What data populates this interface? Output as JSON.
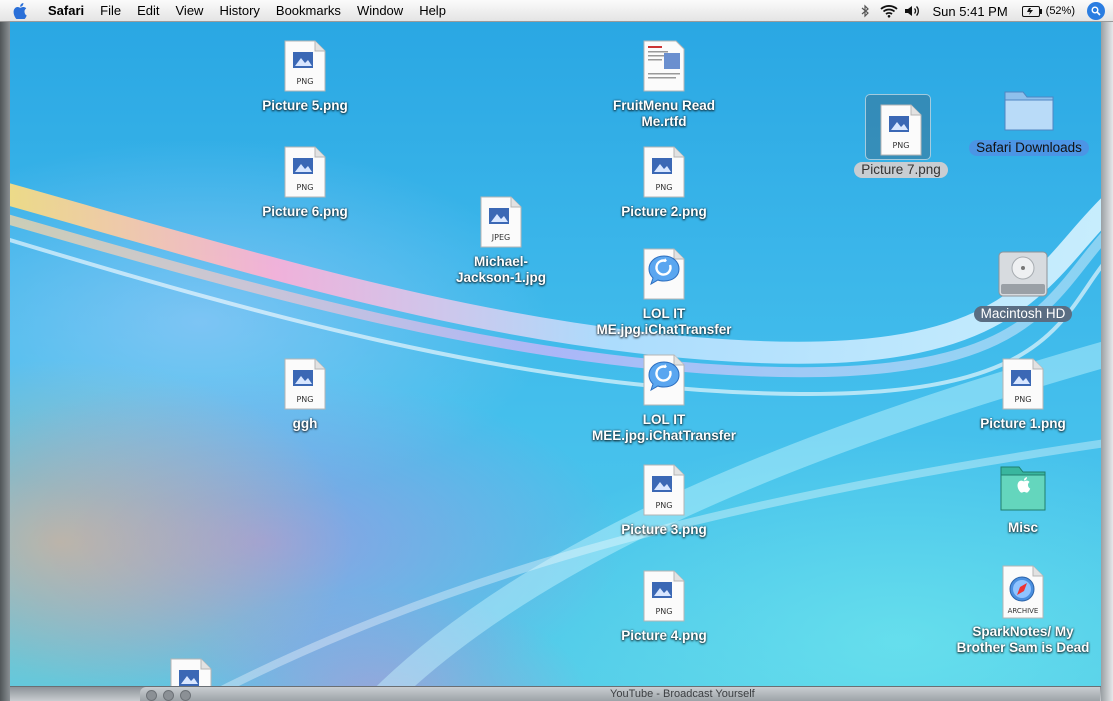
{
  "menubar": {
    "app": "Safari",
    "items": [
      "File",
      "Edit",
      "View",
      "History",
      "Bookmarks",
      "Window",
      "Help"
    ],
    "clock": "Sun 5:41 PM",
    "battery": "(52%)"
  },
  "desktop_icons": {
    "picture5": {
      "name": "Picture 5.png",
      "badge": "PNG"
    },
    "picture6": {
      "name": "Picture 6.png",
      "badge": "PNG"
    },
    "ggh": {
      "name": "ggh",
      "badge": "PNG"
    },
    "michael": {
      "name": "Michael-Jackson-1.jpg",
      "line1": "Michael-",
      "line2": "Jackson-1.jpg",
      "badge": "JPEG"
    },
    "fruitmenu": {
      "line1": "FruitMenu Read",
      "line2": "Me.rtfd"
    },
    "picture2": {
      "name": "Picture 2.png",
      "badge": "PNG"
    },
    "lolit1": {
      "line1": "LOL IT",
      "line2": "ME.jpg.iChatTransfer"
    },
    "lolit2": {
      "line1": "LOL IT",
      "line2": "MEE.jpg.iChatTransfer"
    },
    "picture3": {
      "name": "Picture 3.png",
      "badge": "PNG"
    },
    "picture4": {
      "name": "Picture 4.png",
      "badge": "PNG"
    },
    "picture7": {
      "name": "Picture 7.png",
      "badge": "PNG"
    },
    "safari_downloads": {
      "name": "Safari Downloads"
    },
    "macintosh_hd": {
      "name": "Macintosh HD"
    },
    "picture1": {
      "name": "Picture 1.png",
      "badge": "PNG"
    },
    "misc": {
      "name": "Misc"
    },
    "sparknotes": {
      "line1": "SparkNotes/ My",
      "line2": "Brother Sam is Dead",
      "badge": "ARCHIVE"
    }
  },
  "bottom_window": {
    "title": "YouTube - Broadcast Yourself"
  },
  "colors": {
    "selection": "#4b95e5",
    "desktop": "#3bb6ea"
  }
}
